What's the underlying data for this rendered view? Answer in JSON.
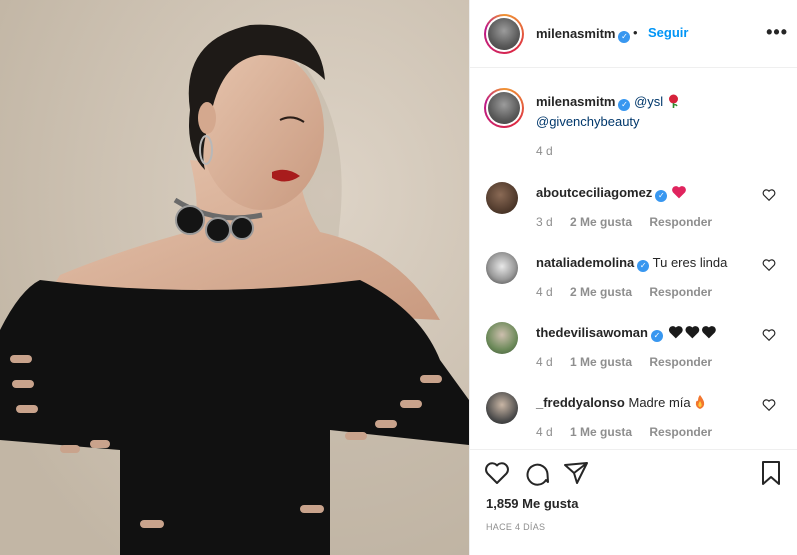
{
  "post": {
    "author": "milenasmitm",
    "follow_label": "Seguir",
    "separator": "•",
    "more_label": "•••"
  },
  "caption": {
    "author": "milenasmitm",
    "mention1": "@ysl",
    "mention2": "@givenchybeauty",
    "time": "4 d"
  },
  "comments": [
    {
      "user": "aboutceciliagomez",
      "verified": true,
      "text": "",
      "time": "3 d",
      "likes": "2 Me gusta",
      "reply": "Responder"
    },
    {
      "user": "nataliademolina",
      "verified": true,
      "text": "Tu eres linda",
      "time": "4 d",
      "likes": "2 Me gusta",
      "reply": "Responder"
    },
    {
      "user": "thedevilisawoman",
      "verified": true,
      "text": "",
      "time": "4 d",
      "likes": "1 Me gusta",
      "reply": "Responder"
    },
    {
      "user": "_freddyalonso",
      "verified": false,
      "text": "Madre mía",
      "time": "4 d",
      "likes": "1 Me gusta",
      "reply": "Responder"
    }
  ],
  "footer": {
    "likes": "1,859 Me gusta",
    "ago": "HACE 4 DÍAS"
  },
  "icons": {
    "verified": "verified-badge-icon",
    "like": "heart-icon",
    "comment": "comment-icon",
    "share": "share-icon",
    "save": "bookmark-icon",
    "more": "more-options-icon"
  },
  "colors": {
    "accent": "#0095f6",
    "verified": "#3897f0",
    "muted": "#8e8e8e",
    "heart_red": "#e0245e"
  }
}
